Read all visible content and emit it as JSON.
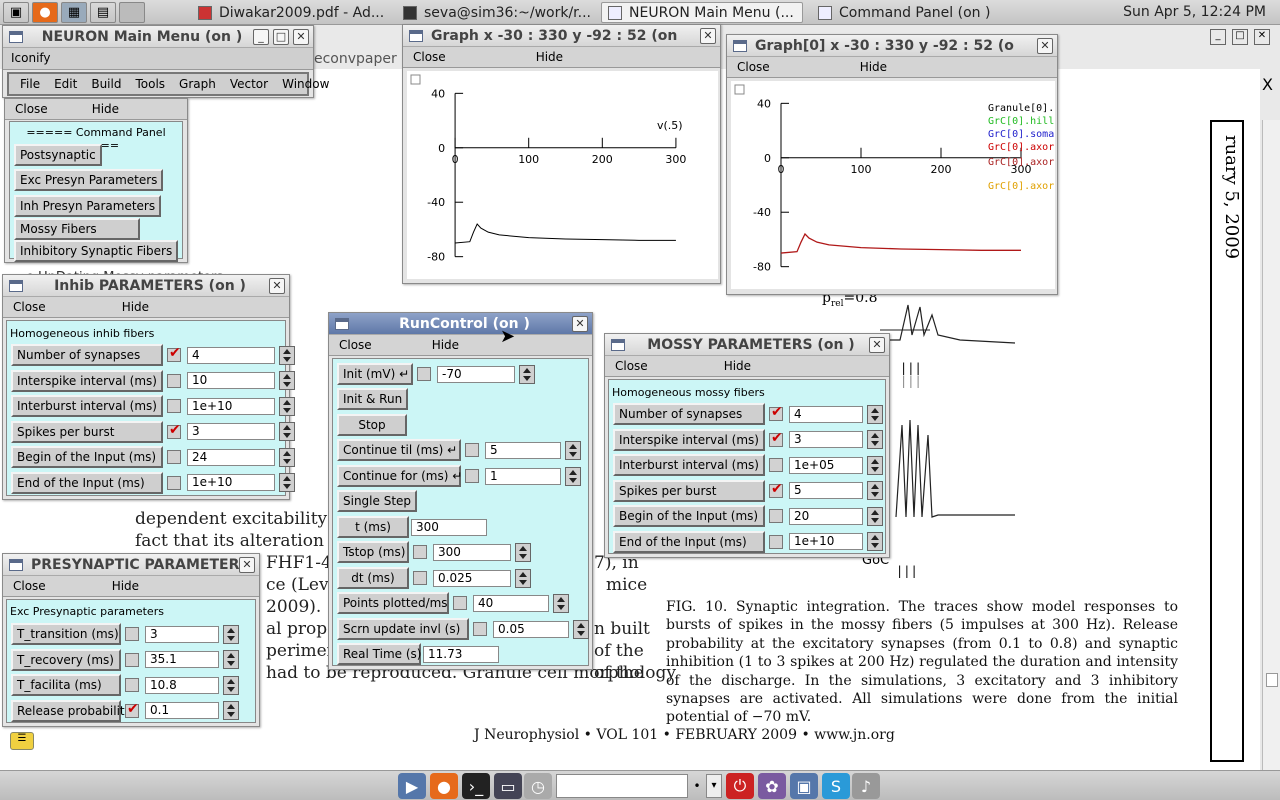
{
  "taskbar": {
    "tasks": [
      {
        "label": "Diwakar2009.pdf - Ad..."
      },
      {
        "label": "seva@sim36:~/work/r..."
      },
      {
        "label": "NEURON Main Menu (..."
      },
      {
        "label": "Command Panel (on )"
      }
    ],
    "clock": "Sun Apr  5, 12:24 PM"
  },
  "document": {
    "filename_fragment": "econvpaper",
    "side_date": "ruary 5, 2009",
    "lines": [
      "dependent excitability",
      "fact that its alteration",
      "FHF1-4",
      "ce (Lev",
      "2009).",
      "al prope",
      "perimen",
      "had to be reproduced. Granule cell morphology"
    ],
    "right_fragments": [
      "7), in",
      "mice",
      "n built",
      "of the",
      "of the"
    ],
    "fig_fragments": {
      "pm": "p",
      "pm_sub": "rel",
      "pm_val": "=0.8",
      "goc": "GoC"
    },
    "caption": "FIG. 10.   Synaptic integration. The traces show model responses to bursts of spikes in the mossy fibers (5 impulses at 300 Hz). Release probability at the excitatory synapses (from 0.1 to 0.8) and synaptic inhibition (1 to 3 spikes at 200 Hz) regulated the duration and intensity of the discharge. In the simulations, 3 excitatory and 3 inhibitory synapses are activated. All simulations were done from the initial potential of −70 mV.",
    "journal": "J Neurophysiol • VOL 101 • FEBRUARY 2009 • www.jn.org",
    "hidden_title": "e UpDating Mossy parameters"
  },
  "main_menu": {
    "title": "NEURON Main Menu (on )",
    "iconify": "Iconify",
    "menus": [
      "File",
      "Edit",
      "Build",
      "Tools",
      "Graph",
      "Vector",
      "Window"
    ]
  },
  "command_panel": {
    "close": "Close",
    "hide": "Hide",
    "heading": "===== Command Panel =====",
    "buttons": [
      "Postsynaptic",
      "Exc Presyn Parameters",
      "Inh Presyn Parameters",
      "Mossy Fibers",
      "Inhibitory Synaptic Fibers"
    ]
  },
  "graph1": {
    "title": "Graph  x -30 : 330  y -92 : 52 (on",
    "close": "Close",
    "hide": "Hide",
    "legend": "v(.5)",
    "x_ticks": [
      "0",
      "100",
      "200",
      "300"
    ],
    "y_ticks": [
      "40",
      "0",
      "-40",
      "-80"
    ]
  },
  "graph2": {
    "title": "Graph[0]  x -30 : 330  y -92 : 52 (o",
    "close": "Close",
    "hide": "Hide",
    "legend": [
      {
        "label": "Granule[0].",
        "color": "#000000"
      },
      {
        "label": "GrC[0].hill",
        "color": "#22bb22"
      },
      {
        "label": "GrC[0].soma",
        "color": "#2222cc"
      },
      {
        "label": "GrC[0].axor",
        "color": "#cc0000"
      },
      {
        "label": "GrC[0].axor",
        "color": "#aa2222"
      },
      {
        "label": "GrC[0].axor",
        "color": "#e0a000"
      }
    ],
    "x_ticks": [
      "0",
      "100",
      "200",
      "300"
    ],
    "y_ticks": [
      "40",
      "0",
      "-40",
      "-80"
    ]
  },
  "chart_data": [
    {
      "type": "line",
      "title": "",
      "xlim": [
        -30,
        330
      ],
      "ylim": [
        -92,
        52
      ],
      "series": [
        {
          "name": "v(.5)",
          "x": [
            0,
            20,
            25,
            30,
            35,
            45,
            60,
            100,
            150,
            200,
            250,
            300
          ],
          "y": [
            -70,
            -69,
            -62,
            -56,
            -59,
            -62,
            -64,
            -66,
            -67,
            -67.5,
            -68,
            -68
          ]
        }
      ]
    },
    {
      "type": "line",
      "title": "",
      "xlim": [
        -30,
        330
      ],
      "ylim": [
        -92,
        52
      ],
      "series": [
        {
          "name": "Granule[0].",
          "x": [
            0,
            20,
            25,
            30,
            35,
            45,
            60,
            100,
            150,
            200,
            250,
            300
          ],
          "y": [
            -70,
            -69,
            -62,
            -56,
            -59,
            -62,
            -64,
            -66,
            -67,
            -67.5,
            -68,
            -68
          ]
        }
      ]
    }
  ],
  "inhib": {
    "title": "Inhib PARAMETERS (on )",
    "close": "Close",
    "hide": "Hide",
    "heading": "Homogeneous inhib fibers",
    "rows": [
      {
        "label": "Number of synapses",
        "value": "4",
        "checked": true
      },
      {
        "label": "Interspike interval (ms)",
        "value": "10",
        "checked": false
      },
      {
        "label": "Interburst interval (ms)",
        "value": "1e+10",
        "checked": false
      },
      {
        "label": "Spikes per burst",
        "value": "3",
        "checked": true
      },
      {
        "label": "Begin of the Input (ms)",
        "value": "24",
        "checked": false
      },
      {
        "label": "End of the Input (ms)",
        "value": "1e+10",
        "checked": false
      }
    ]
  },
  "presyn": {
    "title": "PRESYNAPTIC PARAMETER",
    "close": "Close",
    "hide": "Hide",
    "heading": "Exc Presynaptic parameters",
    "rows": [
      {
        "label": "T_transition (ms)",
        "value": "3",
        "checked": false
      },
      {
        "label": "T_recovery (ms)",
        "value": "35.1",
        "checked": false
      },
      {
        "label": "T_facilita (ms)",
        "value": "10.8",
        "checked": false
      },
      {
        "label": "Release probability",
        "value": "0.1",
        "checked": true
      }
    ]
  },
  "runcontrol": {
    "title": "RunControl (on )",
    "close": "Close",
    "hide": "Hide",
    "init_label": "Init (mV)",
    "init_value": "-70",
    "init_run": "Init & Run",
    "stop": "Stop",
    "continue_til": "Continue til (ms)",
    "continue_til_value": "5",
    "continue_for": "Continue for (ms)",
    "continue_for_value": "1",
    "single_step": "Single Step",
    "t_label": "t (ms)",
    "t_value": "300",
    "tstop_label": "Tstop (ms)",
    "tstop_value": "300",
    "dt_label": "dt (ms)",
    "dt_value": "0.025",
    "points_label": "Points plotted/ms",
    "points_value": "40",
    "scrn_label": "Scrn update invl (s)",
    "scrn_value": "0.05",
    "realtime_label": "Real Time (s)",
    "realtime_value": "11.73"
  },
  "mossy": {
    "title": "MOSSY PARAMETERS (on )",
    "close": "Close",
    "hide": "Hide",
    "heading": "Homogeneous mossy fibers",
    "rows": [
      {
        "label": "Number of synapses",
        "value": "4",
        "checked": true
      },
      {
        "label": "Interspike interval (ms)",
        "value": "3",
        "checked": true
      },
      {
        "label": "Interburst interval (ms)",
        "value": "1e+05",
        "checked": false
      },
      {
        "label": "Spikes per burst",
        "value": "5",
        "checked": true
      },
      {
        "label": "Begin of the Input (ms)",
        "value": "20",
        "checked": false
      },
      {
        "label": "End of the Input (ms)",
        "value": "1e+10",
        "checked": false
      }
    ]
  }
}
